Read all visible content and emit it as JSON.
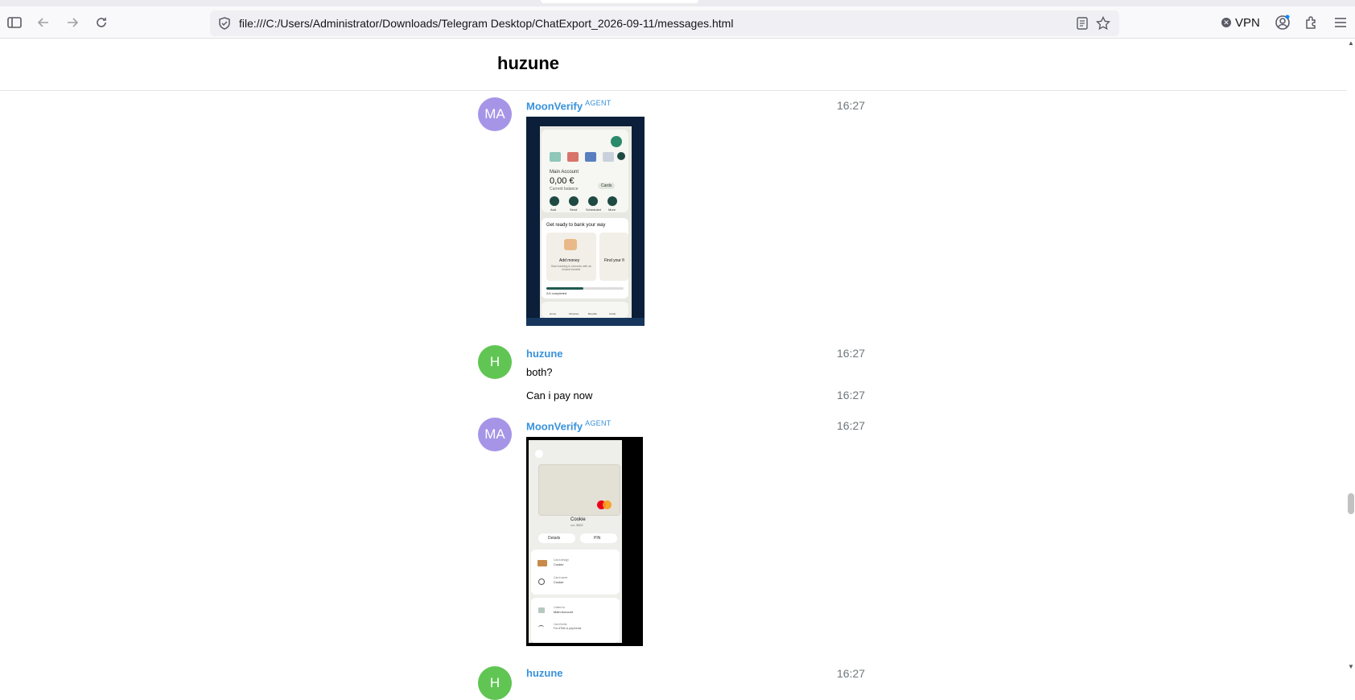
{
  "browser": {
    "url": "file:///C:/Users/Administrator/Downloads/Telegram Desktop/ChatExport_2026-09-11/messages.html",
    "vpn_label": "VPN"
  },
  "chat": {
    "title": "huzune",
    "messages": [
      {
        "avatar": "MA",
        "from": "MoonVerify",
        "badge": "AGENT",
        "time": "16:27"
      },
      {
        "avatar": "H",
        "from": "huzune",
        "text": "both?",
        "time": "16:27"
      },
      {
        "text": "Can i pay now",
        "time": "16:27"
      },
      {
        "avatar": "MA",
        "from": "MoonVerify",
        "badge": "AGENT",
        "time": "16:27"
      },
      {
        "avatar": "H",
        "from": "huzune",
        "time": "16:27"
      }
    ]
  },
  "shot1": {
    "account_label": "Main Account",
    "balance": "0,00 €",
    "balance_caption": "Current balance",
    "cards_chip": "Cards",
    "actions": [
      "Add",
      "Send",
      "Scheduled",
      "More"
    ],
    "promo_title": "Get ready to bank your way",
    "promo_card_title": "Add money",
    "promo_card_text": "Start banking in seconds with an instant transfer",
    "promo_card2_title": "Find your fi",
    "progress_label": "2/4 completed",
    "nav": [
      "Home",
      "Finances",
      "Benefits",
      "Cards"
    ]
  },
  "shot2": {
    "card_name": "Cookie",
    "card_number": "•••• 3002",
    "details_btn": "Details",
    "pin_btn": "PIN",
    "rows": [
      {
        "label": "Card design",
        "value": "Cookie"
      },
      {
        "label": "Card name",
        "value": "Cookie"
      },
      {
        "label": "Linked to",
        "value": "Main Account"
      },
      {
        "label": "Card limits",
        "value": "For ATMs & payments"
      }
    ]
  }
}
